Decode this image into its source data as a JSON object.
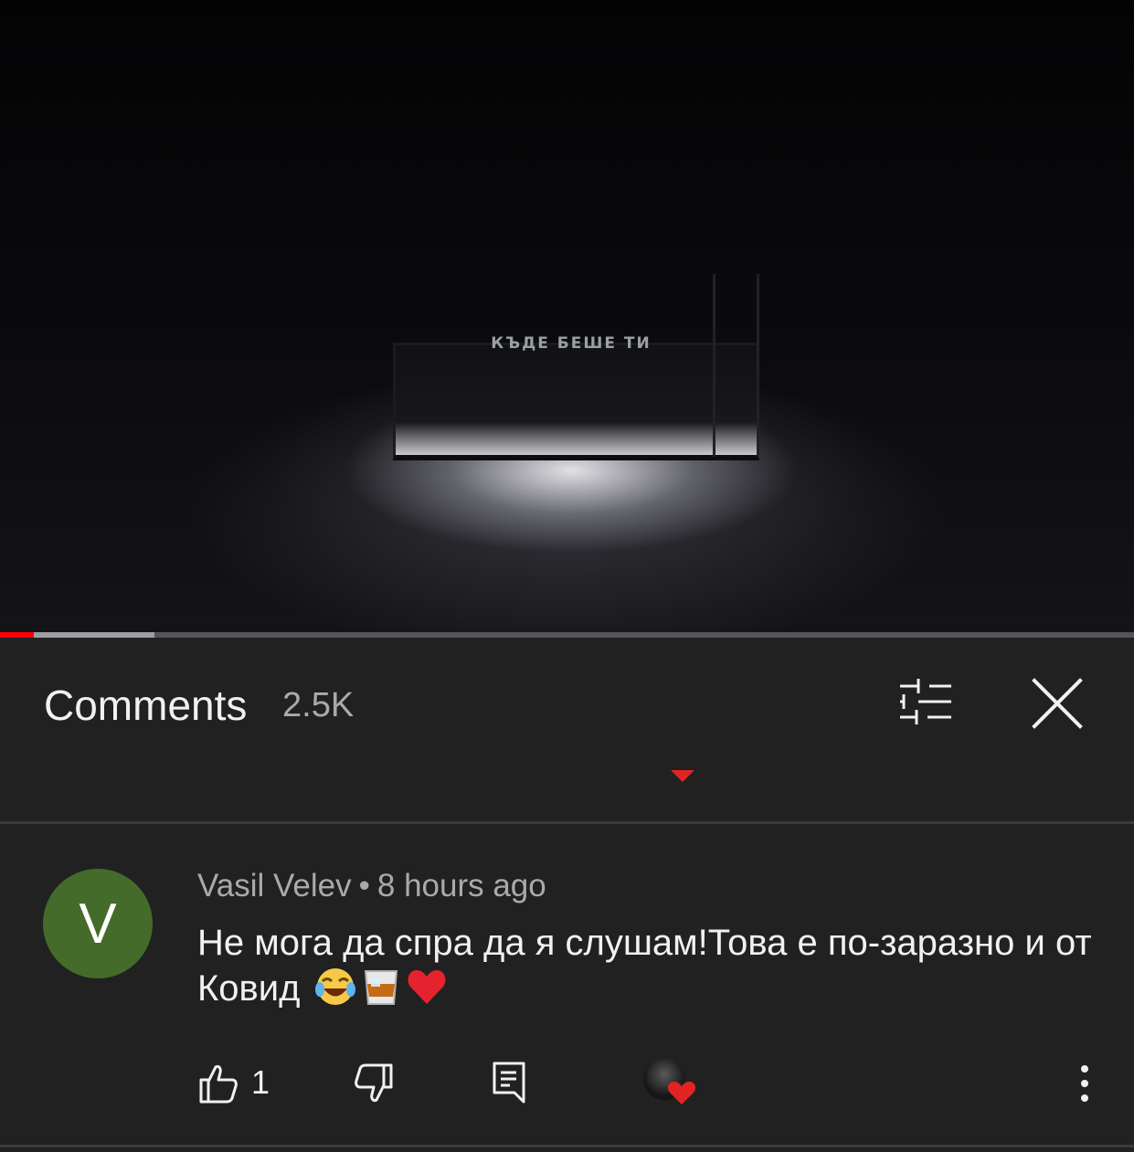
{
  "video": {
    "overlay_title": "КЪДЕ БЕШЕ ТИ",
    "progress_played_fraction": 0.03,
    "progress_buffered_fraction": 0.136,
    "accent_color": "#ff0000"
  },
  "comments_panel": {
    "title": "Comments",
    "count": "2.5K",
    "filter_icon": "sort-filter-icon",
    "close_icon": "close-icon"
  },
  "comment": {
    "avatar_letter": "V",
    "avatar_color": "#446b2a",
    "author": "Vasil Velev",
    "separator": "•",
    "time": "8 hours ago",
    "text": "Не мога да спра да я слушам!Това е по-заразно и от Ковид",
    "emojis": [
      "tears-of-joy-emoji",
      "whiskey-glass-emoji",
      "red-heart-emoji"
    ],
    "like_count": "1"
  }
}
